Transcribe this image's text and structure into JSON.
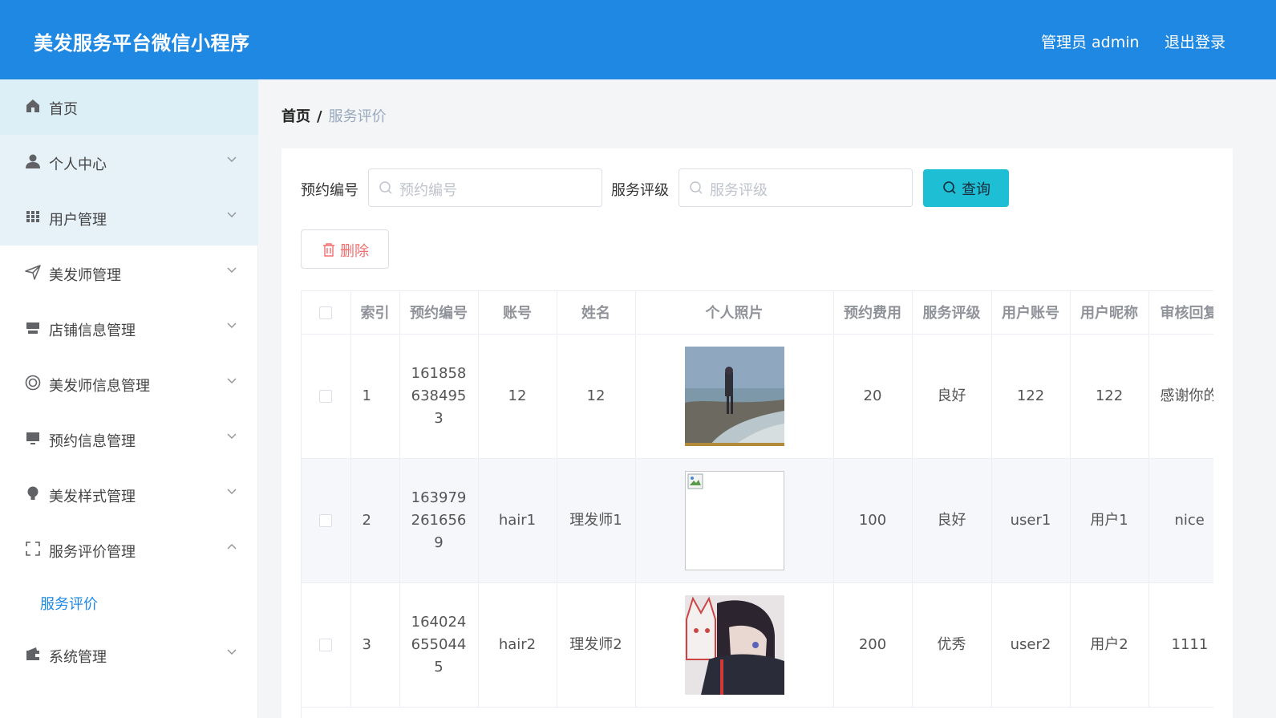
{
  "app": {
    "title": "美发服务平台微信小程序",
    "admin_label": "管理员 admin",
    "logout_label": "退出登录"
  },
  "colors": {
    "header": "#1f88e3",
    "accent": "#1f88e3",
    "query_button": "#1ebfd4",
    "delete_text": "#f56c6c"
  },
  "sidebar": {
    "items": [
      {
        "label": "首页",
        "icon": "home-icon"
      },
      {
        "label": "个人中心",
        "icon": "user-icon"
      },
      {
        "label": "用户管理",
        "icon": "grid-icon"
      },
      {
        "label": "美发师管理",
        "icon": "send-icon"
      },
      {
        "label": "店铺信息管理",
        "icon": "store-icon"
      },
      {
        "label": "美发师信息管理",
        "icon": "circle-icon"
      },
      {
        "label": "预约信息管理",
        "icon": "monitor-icon"
      },
      {
        "label": "美发样式管理",
        "icon": "bulb-icon"
      },
      {
        "label": "服务评价管理",
        "icon": "frame-icon"
      },
      {
        "label": "系统管理",
        "icon": "wallet-icon"
      }
    ],
    "subitem": "服务评价"
  },
  "breadcrumb": {
    "home": "首页",
    "separator": "/",
    "current": "服务评价"
  },
  "search": {
    "field1_label": "预约编号",
    "field1_placeholder": "预约编号",
    "field2_label": "服务评级",
    "field2_placeholder": "服务评级",
    "query_label": "查询"
  },
  "actions": {
    "delete_label": "删除"
  },
  "table": {
    "headers": [
      "索引",
      "预约编号",
      "账号",
      "姓名",
      "个人照片",
      "预约费用",
      "服务评级",
      "用户账号",
      "用户昵称",
      "审核回复"
    ],
    "rows": [
      {
        "index": "1",
        "booking_no": "1618586384953",
        "account": "12",
        "name": "12",
        "photo": "photo-beach",
        "fee": "20",
        "rating": "良好",
        "user_account": "122",
        "nickname": "122",
        "reply": "感谢你的评价"
      },
      {
        "index": "2",
        "booking_no": "1639792616569",
        "account": "hair1",
        "name": "理发师1",
        "photo": "photo-broken",
        "fee": "100",
        "rating": "良好",
        "user_account": "user1",
        "nickname": "用户1",
        "reply": "nice"
      },
      {
        "index": "3",
        "booking_no": "1640246550445",
        "account": "hair2",
        "name": "理发师2",
        "photo": "photo-anime",
        "fee": "200",
        "rating": "优秀",
        "user_account": "user2",
        "nickname": "用户2",
        "reply": "1111"
      }
    ]
  }
}
